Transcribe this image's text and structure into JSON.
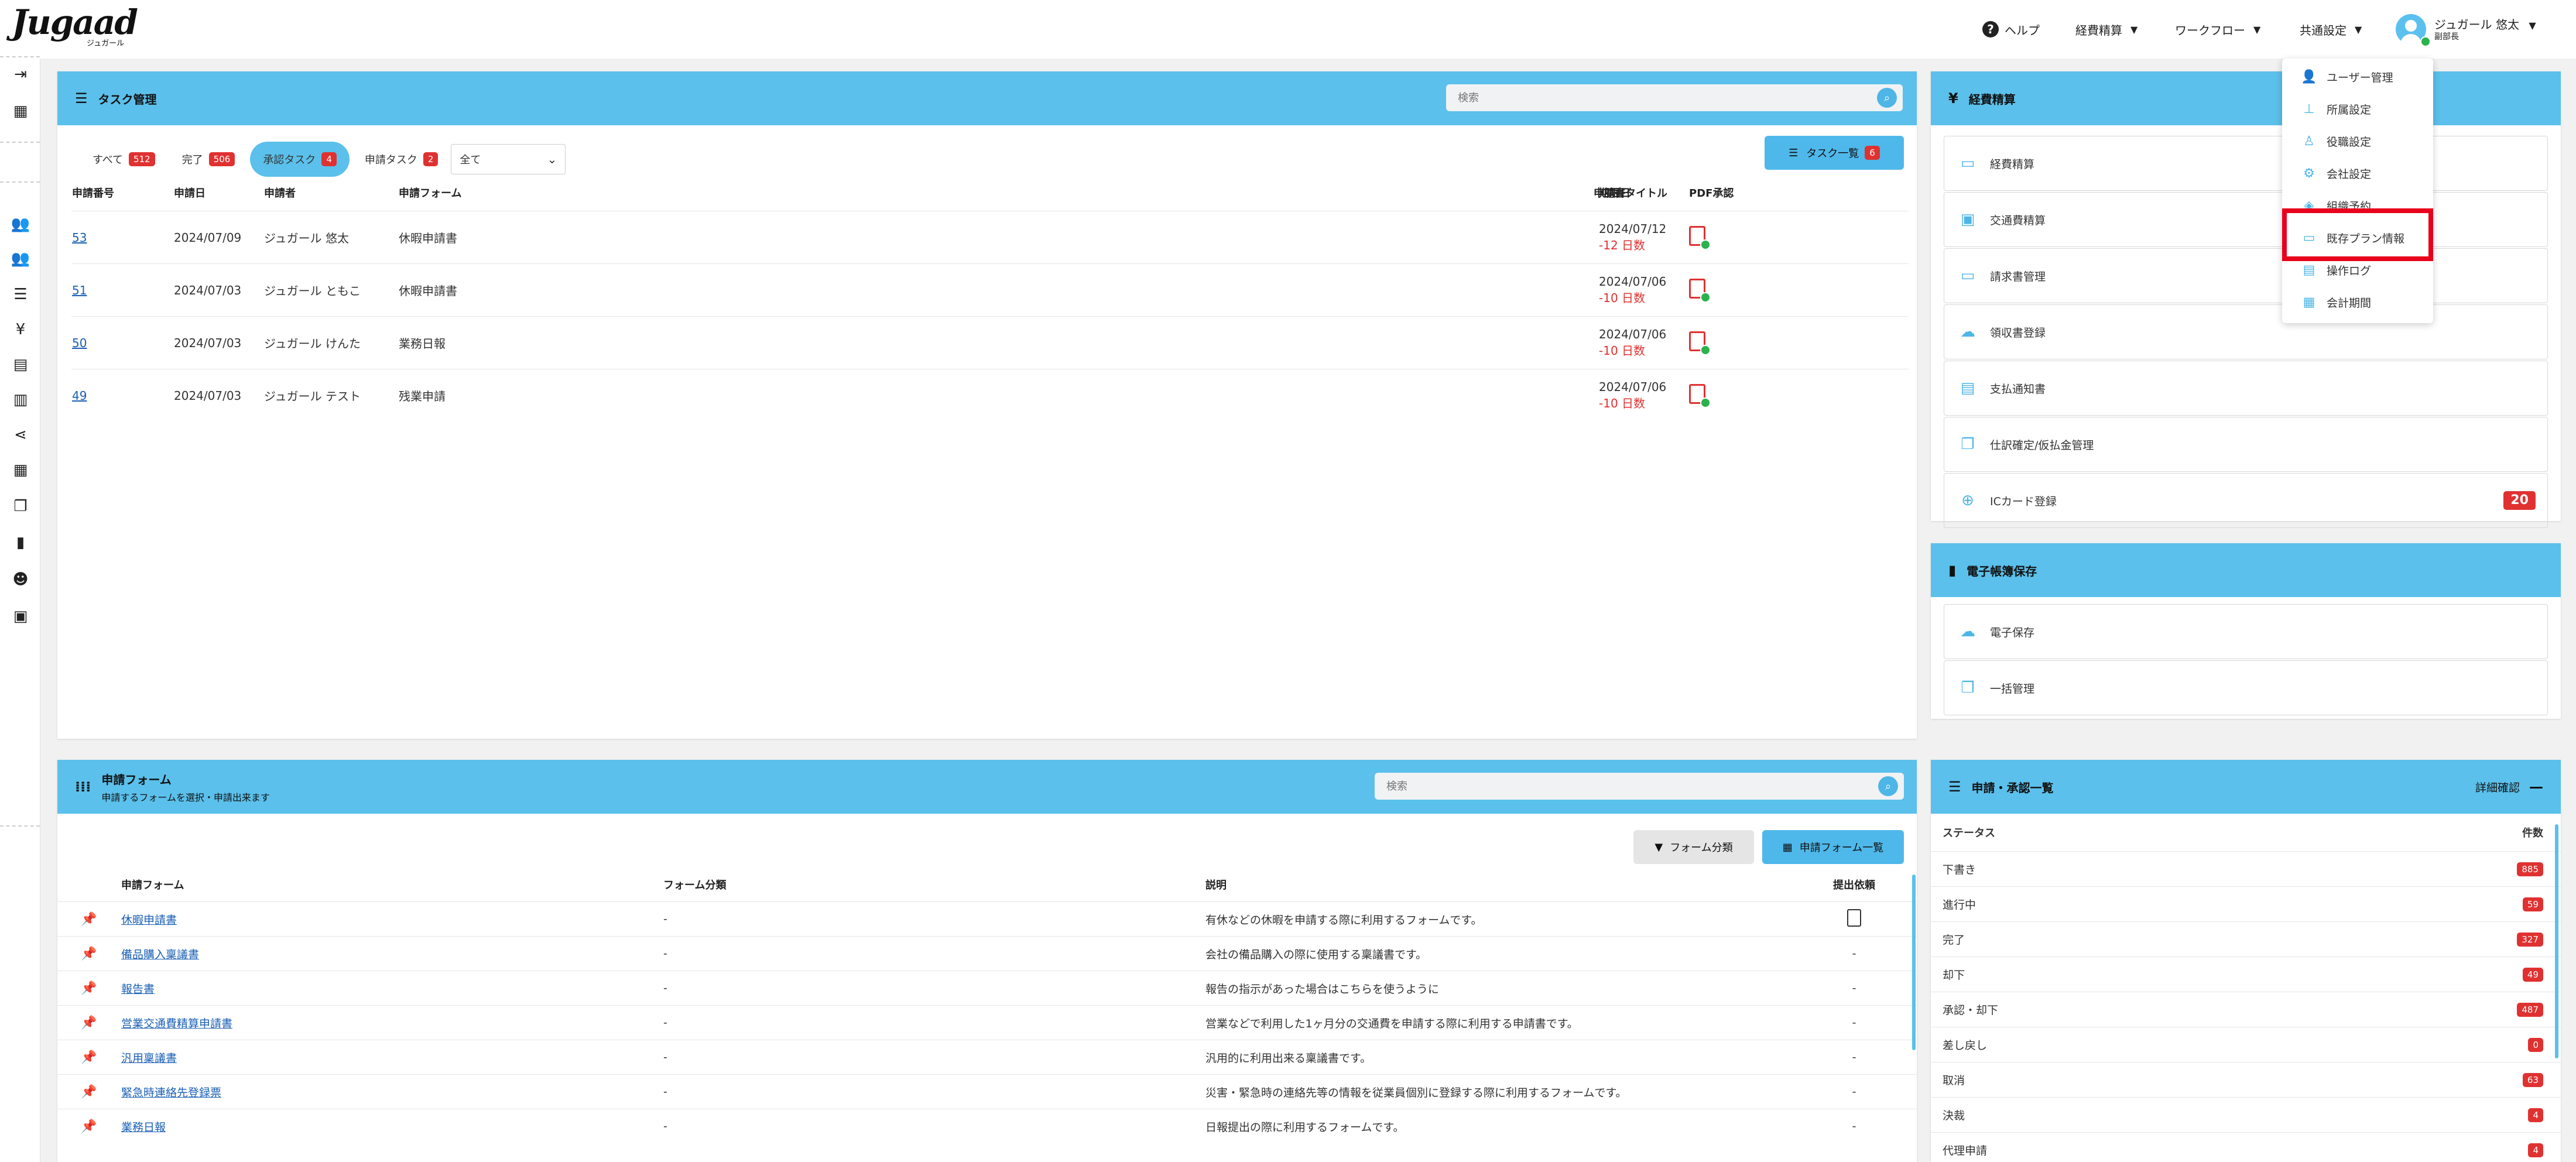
{
  "header": {
    "logo": "Jugaad",
    "logo_sub": "ジュガール",
    "nav": [
      {
        "label": "ヘルプ"
      },
      {
        "label": "経費精算"
      },
      {
        "label": "ワークフロー"
      },
      {
        "label": "共通設定"
      }
    ],
    "user_name": "ジュガール 悠太",
    "user_role": "副部長"
  },
  "sidebar_icons": [
    "collapse-icon",
    "calculator-icon",
    "users-icon",
    "user-group-icon",
    "list-icon",
    "yen-icon",
    "document-icon",
    "receipt-icon",
    "share-icon",
    "table-icon",
    "copy-icon",
    "file-icon",
    "support-icon",
    "wallet-icon"
  ],
  "task_panel": {
    "title": "タスク管理",
    "search_placeholder": "検索",
    "tabs": [
      {
        "label": "すべて",
        "count": "512"
      },
      {
        "label": "完了",
        "count": "506"
      },
      {
        "label": "承認タスク",
        "count": "4",
        "active": true
      },
      {
        "label": "申請タスク",
        "count": "2"
      }
    ],
    "filter_value": "全て",
    "list_button": "タスク一覧",
    "list_count": "6",
    "columns": [
      "申請番号",
      "申請日",
      "申請者",
      "申請フォーム",
      "申請書タイトル",
      "期限日",
      "PDF承認"
    ],
    "rows": [
      {
        "no": "53",
        "date": "2024/07/09",
        "applicant": "ジュガール 悠太",
        "form": "休暇申請書",
        "title": "",
        "due": "2024/07/12",
        "overdue": "-12 日数"
      },
      {
        "no": "51",
        "date": "2024/07/03",
        "applicant": "ジュガール ともこ",
        "form": "休暇申請書",
        "title": "",
        "due": "2024/07/06",
        "overdue": "-10 日数"
      },
      {
        "no": "50",
        "date": "2024/07/03",
        "applicant": "ジュガール けんた",
        "form": "業務日報",
        "title": "",
        "due": "2024/07/06",
        "overdue": "-10 日数"
      },
      {
        "no": "49",
        "date": "2024/07/03",
        "applicant": "ジュガール テスト",
        "form": "残業申請",
        "title": "",
        "due": "2024/07/06",
        "overdue": "-10 日数"
      }
    ]
  },
  "expense_panel": {
    "title": "経費精算",
    "items": [
      {
        "label": "経費精算",
        "icon": "card-icon"
      },
      {
        "label": "交通費精算",
        "icon": "train-icon"
      },
      {
        "label": "請求書管理",
        "icon": "invoice-icon"
      },
      {
        "label": "領収書登録",
        "icon": "upload-cloud-icon"
      },
      {
        "label": "支払通知書",
        "icon": "notice-icon"
      },
      {
        "label": "仕訳確定/仮払金管理",
        "icon": "journal-icon"
      },
      {
        "label": "ICカード登録",
        "icon": "globe-icon",
        "badge": "20"
      }
    ]
  },
  "ebook_panel": {
    "title": "電子帳簿保存",
    "items": [
      {
        "label": "電子保存",
        "icon": "upload-cloud-icon"
      },
      {
        "label": "一括管理",
        "icon": "copy-icon"
      }
    ]
  },
  "settings_dropdown": {
    "items": [
      {
        "label": "ユーザー管理",
        "icon": "user-plus-icon"
      },
      {
        "label": "所属設定",
        "icon": "org-chart-icon"
      },
      {
        "label": "役職設定",
        "icon": "role-icon"
      },
      {
        "label": "会社設定",
        "icon": "gear-icon"
      },
      {
        "label": "組織予約",
        "icon": "layers-icon"
      },
      {
        "label": "既存プラン情報",
        "icon": "card-icon",
        "highlighted": true
      },
      {
        "label": "操作ログ",
        "icon": "log-icon"
      },
      {
        "label": "会計期間",
        "icon": "calendar-icon"
      }
    ]
  },
  "form_panel": {
    "title": "申請フォーム",
    "subtitle": "申請するフォームを選択・申請出来ます",
    "search_placeholder": "検索",
    "category_button": "フォーム分類",
    "list_button": "申請フォーム一覧",
    "columns": [
      "申請フォーム",
      "フォーム分類",
      "説明",
      "提出依頼"
    ],
    "rows": [
      {
        "name": "休暇申請書",
        "category": "-",
        "desc": "有休などの休暇を申請する際に利用するフォームです。",
        "submit": "icon"
      },
      {
        "name": "備品購入稟議書",
        "category": "-",
        "desc": "会社の備品購入の際に使用する稟議書です。",
        "submit": "-"
      },
      {
        "name": "報告書",
        "category": "-",
        "desc": "報告の指示があった場合はこちらを使うように",
        "submit": "-"
      },
      {
        "name": "営業交通費精算申請書",
        "category": "-",
        "desc": "営業などで利用した1ヶ月分の交通費を申請する際に利用する申請書です。",
        "submit": "-"
      },
      {
        "name": "汎用稟議書",
        "category": "-",
        "desc": "汎用的に利用出来る稟議書です。",
        "submit": "-"
      },
      {
        "name": "緊急時連絡先登録票",
        "category": "-",
        "desc": "災害・緊急時の連絡先等の情報を従業員個別に登録する際に利用するフォームです。",
        "submit": "-"
      },
      {
        "name": "業務日報",
        "category": "-",
        "desc": "日報提出の際に利用するフォームです。",
        "submit": "-"
      }
    ]
  },
  "status_panel": {
    "title": "申請・承認一覧",
    "detail_link": "詳細確認",
    "col_status": "ステータス",
    "col_count": "件数",
    "rows": [
      {
        "label": "下書き",
        "count": "885"
      },
      {
        "label": "進行中",
        "count": "59"
      },
      {
        "label": "完了",
        "count": "327"
      },
      {
        "label": "却下",
        "count": "49"
      },
      {
        "label": "承認・却下",
        "count": "487"
      },
      {
        "label": "差し戻し",
        "count": "0"
      },
      {
        "label": "取消",
        "count": "63"
      },
      {
        "label": "決裁",
        "count": "4"
      },
      {
        "label": "代理申請",
        "count": "4"
      }
    ]
  },
  "colors": {
    "header_blue": "#5bc0eb",
    "badge_red": "#e03131",
    "highlight_red": "#e8001c"
  }
}
